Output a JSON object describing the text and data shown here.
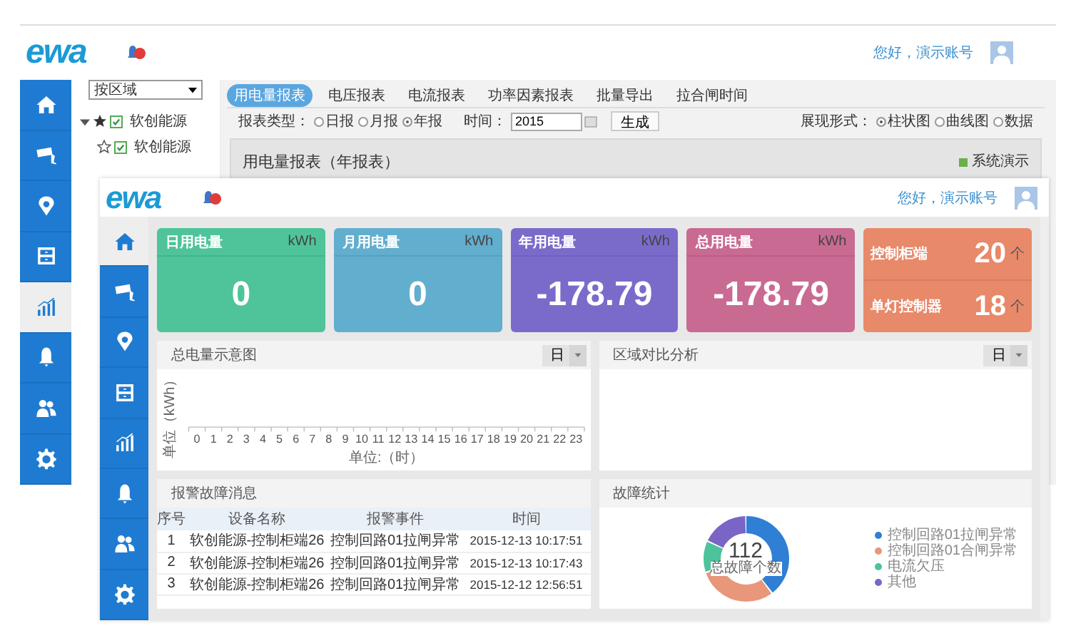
{
  "back_window": {
    "logo": "ewa",
    "greeting": "您好，演示账号",
    "nav": [
      {
        "selected": false
      },
      {
        "selected": false
      },
      {
        "selected": false
      },
      {
        "selected": false
      },
      {
        "selected": true
      },
      {
        "selected": false
      },
      {
        "selected": false
      },
      {
        "selected": false
      }
    ],
    "region_select": "按区域",
    "tree": [
      {
        "label": "软创能源",
        "expanded": true,
        "starred": true,
        "checked": true,
        "children": [
          {
            "label": "软创能源",
            "starred": false,
            "checked": true
          }
        ]
      }
    ],
    "tabs": [
      {
        "label": "用电量报表",
        "selected": true
      },
      {
        "label": "电压报表",
        "selected": false
      },
      {
        "label": "电流报表",
        "selected": false
      },
      {
        "label": "功率因素报表",
        "selected": false
      },
      {
        "label": "批量导出",
        "selected": false
      },
      {
        "label": "拉合闸时间",
        "selected": false
      }
    ],
    "report_type": {
      "label": "报表类型：",
      "options": [
        {
          "label": "日报",
          "selected": false
        },
        {
          "label": "月报",
          "selected": false
        },
        {
          "label": "年报",
          "selected": true
        }
      ]
    },
    "time": {
      "label": "时间：",
      "value": "2015"
    },
    "generate_button": "生成",
    "display": {
      "label": "展现形式：",
      "options": [
        {
          "label": "柱状图",
          "selected": true
        },
        {
          "label": "曲线图",
          "selected": false
        },
        {
          "label": "数据",
          "selected": false
        }
      ]
    },
    "panel_title": "用电量报表（年报表）",
    "legend": "系统演示"
  },
  "front_window": {
    "logo": "ewa",
    "greeting": "您好，演示账号",
    "nav": [
      {
        "selected": true
      },
      {
        "selected": false
      },
      {
        "selected": false
      },
      {
        "selected": false
      },
      {
        "selected": false
      },
      {
        "selected": false
      },
      {
        "selected": false
      },
      {
        "selected": false
      }
    ],
    "cards": [
      {
        "kind": "metric",
        "title": "日用电量",
        "unit": "kWh",
        "value": "0",
        "color": "#4fc49b"
      },
      {
        "kind": "metric",
        "title": "月用电量",
        "unit": "kWh",
        "value": "0",
        "color": "#62aecf"
      },
      {
        "kind": "metric",
        "title": "年用电量",
        "unit": "kWh",
        "value": "-178.79",
        "color": "#7a6bcb"
      },
      {
        "kind": "metric",
        "title": "总用电量",
        "unit": "kWh",
        "value": "-178.79",
        "color": "#c96a93"
      },
      {
        "kind": "counts",
        "color": "#e8896a",
        "rows": [
          {
            "label": "控制柜端",
            "value": "20",
            "unit": "个"
          },
          {
            "label": "单灯控制器",
            "value": "18",
            "unit": "个"
          }
        ]
      }
    ],
    "chart_panel": {
      "title": "总电量示意图",
      "period": "日",
      "ylabel": "单位（kWh）",
      "xlabel": "单位:（时）",
      "x_ticks": [
        "0",
        "1",
        "2",
        "3",
        "4",
        "5",
        "6",
        "7",
        "8",
        "9",
        "10",
        "11",
        "12",
        "13",
        "14",
        "15",
        "16",
        "17",
        "18",
        "19",
        "20",
        "21",
        "22",
        "23"
      ]
    },
    "compare_panel": {
      "title": "区域对比分析",
      "period": "日"
    },
    "alarm_panel": {
      "title": "报警故障消息",
      "columns": [
        "序号",
        "设备名称",
        "报警事件",
        "时间"
      ],
      "rows": [
        [
          "1",
          "软创能源-控制柜端26",
          "控制回路01拉闸异常",
          "2015-12-13 10:17:51"
        ],
        [
          "2",
          "软创能源-控制柜端26",
          "控制回路01拉闸异常",
          "2015-12-13 10:17:43"
        ],
        [
          "3",
          "软创能源-控制柜端26",
          "控制回路01拉闸异常",
          "2015-12-12 12:56:51"
        ]
      ]
    },
    "fault_panel": {
      "title": "故障统计",
      "total": "112",
      "total_label": "总故障个数",
      "legend": [
        {
          "label": "控制回路01拉闸异常",
          "color": "#2f7fd4"
        },
        {
          "label": "控制回路01合闸异常",
          "color": "#e8977a"
        },
        {
          "label": "电流欠压",
          "color": "#4cc39a"
        },
        {
          "label": "其他",
          "color": "#7a64c6"
        }
      ]
    }
  }
}
